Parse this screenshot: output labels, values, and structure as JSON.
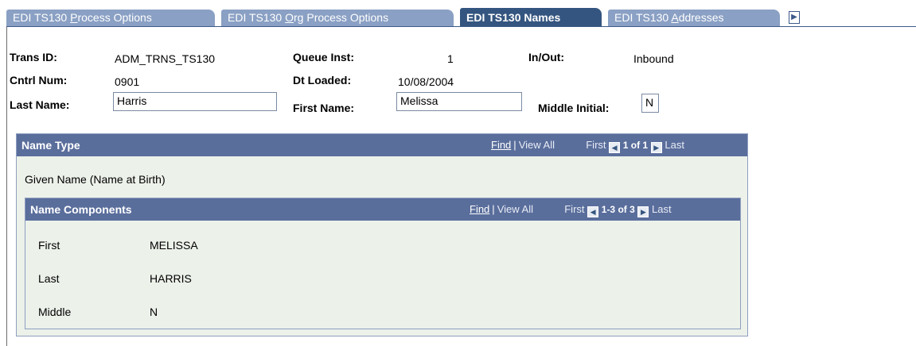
{
  "tabs": [
    {
      "pre": "EDI TS130 ",
      "ul": "P",
      "post": "rocess Options",
      "active": false
    },
    {
      "pre": "EDI TS130 ",
      "ul": "O",
      "post": "rg Process Options",
      "active": false
    },
    {
      "label": "EDI TS130 Names",
      "active": true
    },
    {
      "pre": "EDI TS130 ",
      "ul": "A",
      "post": "ddresses",
      "active": false
    }
  ],
  "tab_more_icon": "triangle-right",
  "header": {
    "trans_id_label": "Trans ID:",
    "trans_id_value": "ADM_TRNS_TS130",
    "queue_inst_label": "Queue Inst:",
    "queue_inst_value": "1",
    "in_out_label": "In/Out:",
    "in_out_value": "Inbound",
    "cntrl_num_label": "Cntrl Num:",
    "cntrl_num_value": "0901",
    "dt_loaded_label": "Dt Loaded:",
    "dt_loaded_value": "10/08/2004",
    "last_name_label": "Last Name:",
    "last_name_value": "Harris",
    "first_name_label": "First Name:",
    "first_name_value": "Melissa",
    "middle_initial_label": "Middle Initial:",
    "middle_initial_value": "N"
  },
  "name_type_grid": {
    "title": "Name Type",
    "find": "Find",
    "sep": "|",
    "view_all": "View All",
    "first": "First",
    "count": "1 of 1",
    "last": "Last",
    "value": "Given Name (Name at Birth)"
  },
  "name_components_grid": {
    "title": "Name Components",
    "find": "Find",
    "sep": "|",
    "view_all": "View All",
    "first": "First",
    "count": "1-3 of 3",
    "last": "Last",
    "rows": [
      {
        "label": "First",
        "value": "MELISSA"
      },
      {
        "label": "Last",
        "value": "HARRIS"
      },
      {
        "label": "Middle",
        "value": "N"
      }
    ]
  },
  "colors": {
    "tab_inactive": "#8aa0c4",
    "tab_active": "#34557f",
    "grid_header": "#5a6e9c",
    "grid_body": "#ecf1ea"
  }
}
